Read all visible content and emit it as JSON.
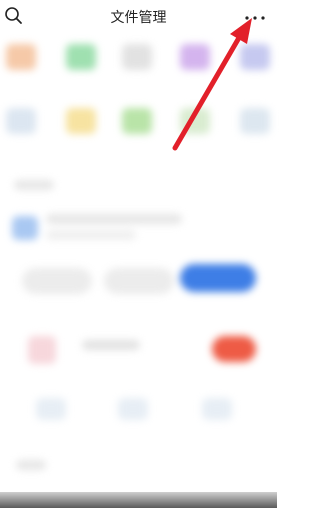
{
  "header": {
    "title": "文件管理"
  },
  "icons": {
    "search": "search-icon",
    "more": "more-options-icon",
    "annotation": "red-arrow-pointer"
  },
  "colors": {
    "arrow": "#e2202a",
    "primary_blue": "#3e7ee6",
    "accent_red": "#ee5b45"
  }
}
